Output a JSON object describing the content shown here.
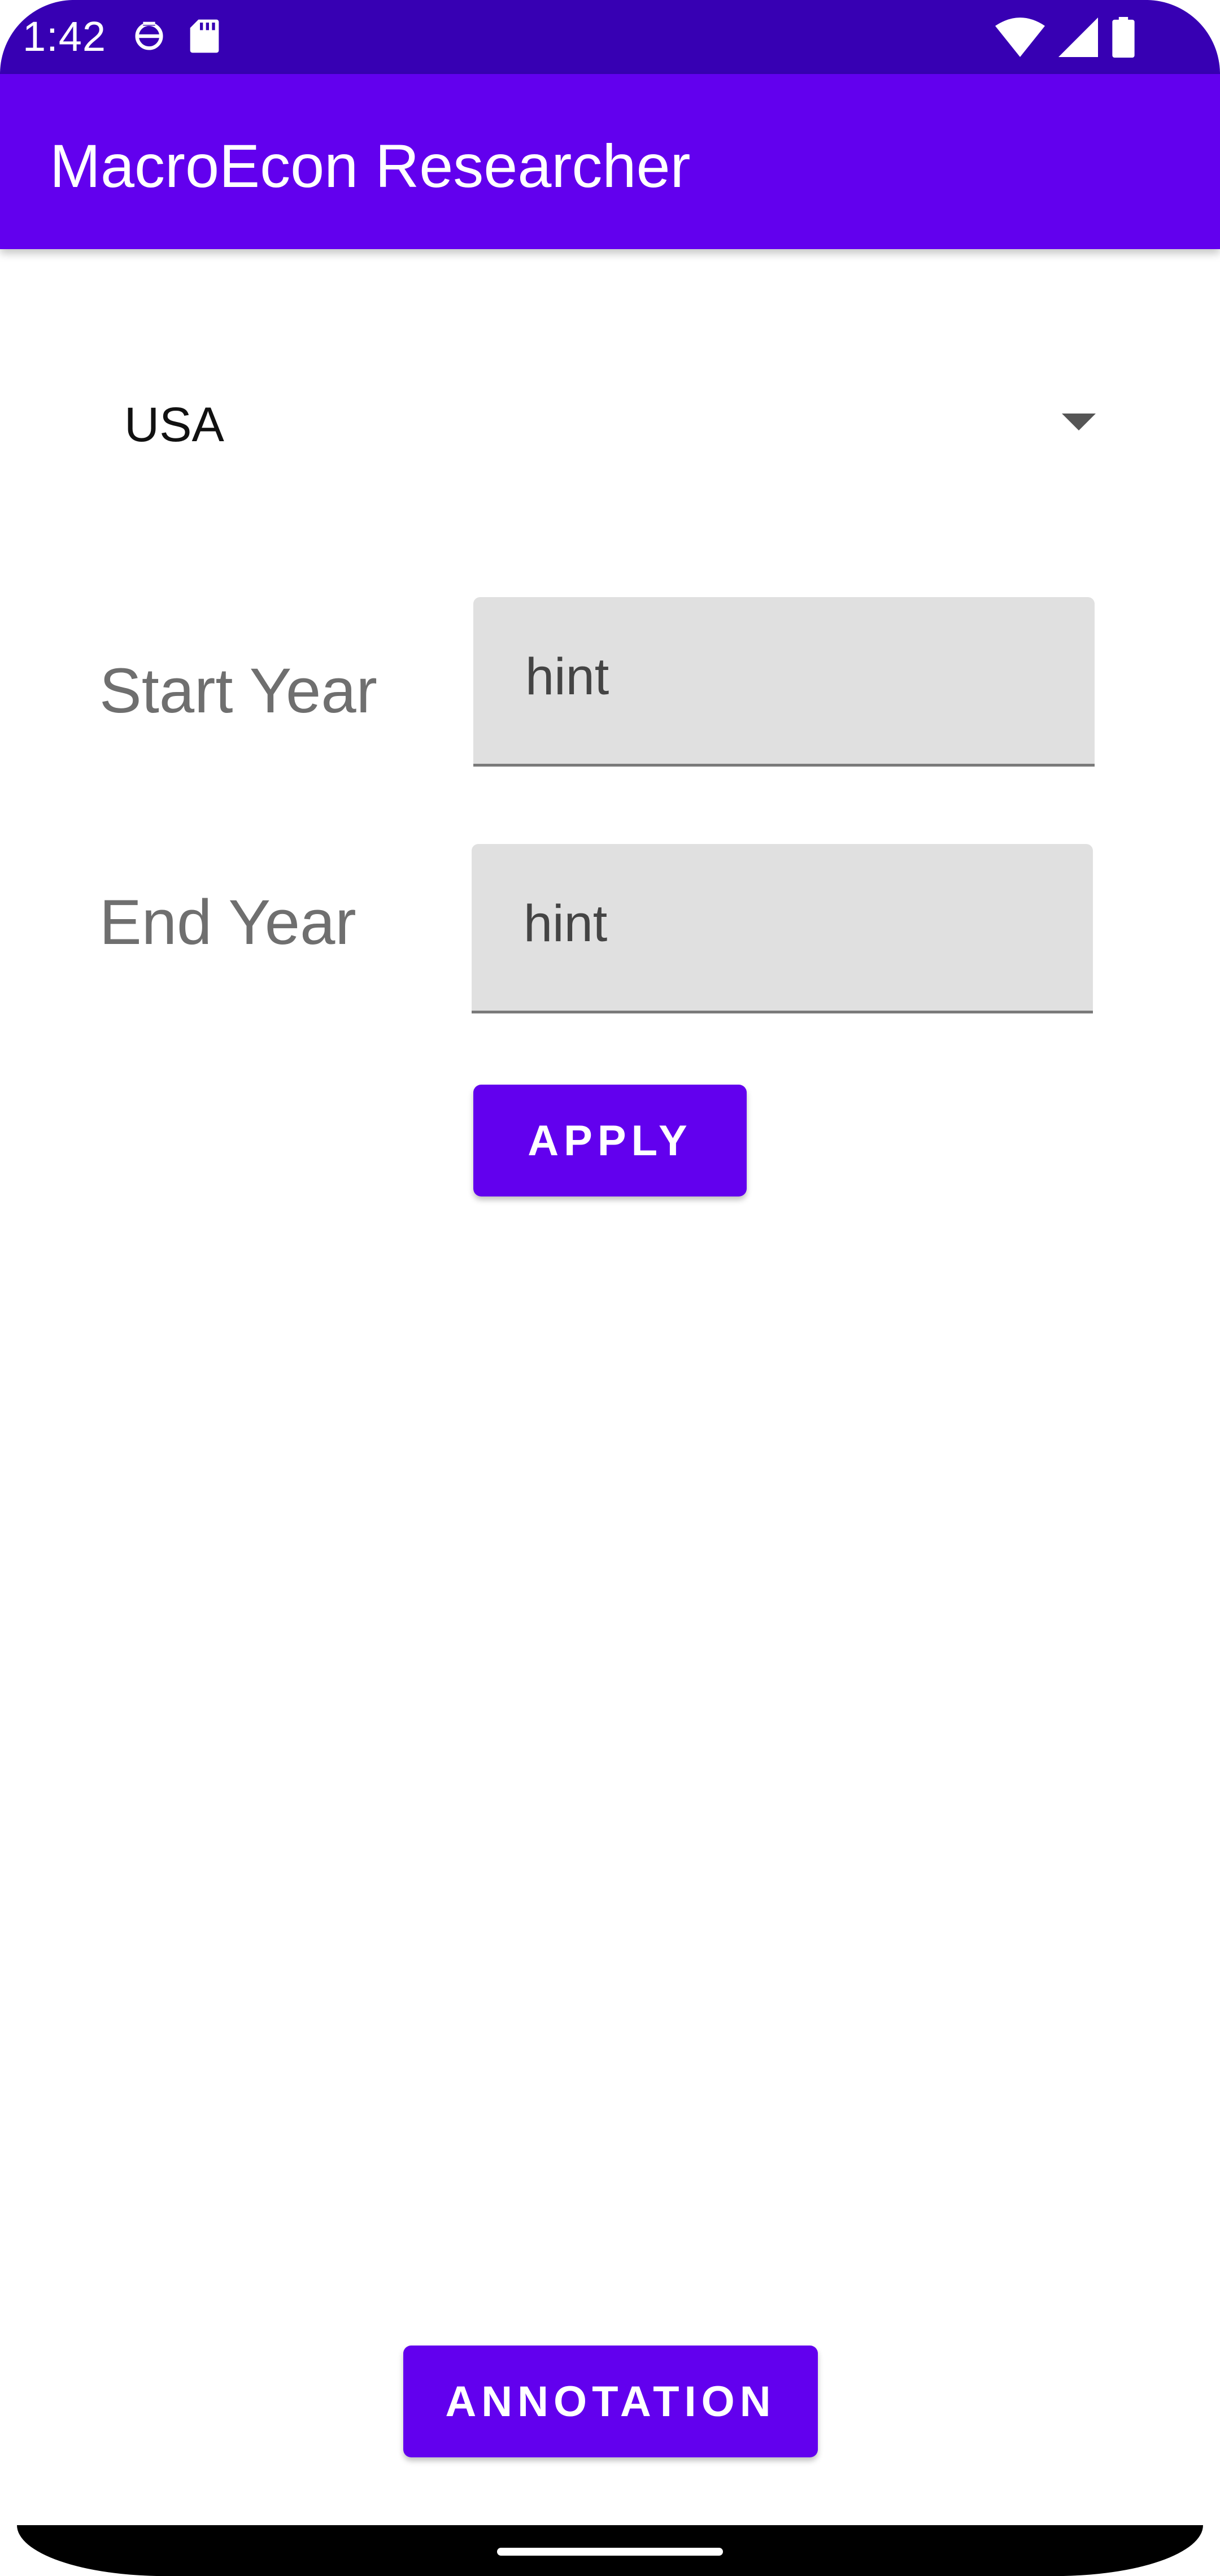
{
  "status_bar": {
    "time": "1:42",
    "icons": [
      "settings-ring-icon",
      "sd-card-icon",
      "wifi-icon",
      "cell-signal-icon",
      "battery-icon"
    ]
  },
  "app_bar": {
    "title": "MacroEcon Researcher"
  },
  "country_spinner": {
    "selected": "USA"
  },
  "start_year": {
    "label": "Start Year",
    "value": "",
    "placeholder": "hint"
  },
  "end_year": {
    "label": "End Year",
    "value": "",
    "placeholder": "hint"
  },
  "buttons": {
    "apply_label": "APPLY",
    "annotation_label": "ANNOTATION"
  },
  "colors": {
    "status_bar": "#3700b3",
    "primary": "#6200ee",
    "field_bg": "#e0e0e0",
    "label_text": "#6f6f6f"
  }
}
